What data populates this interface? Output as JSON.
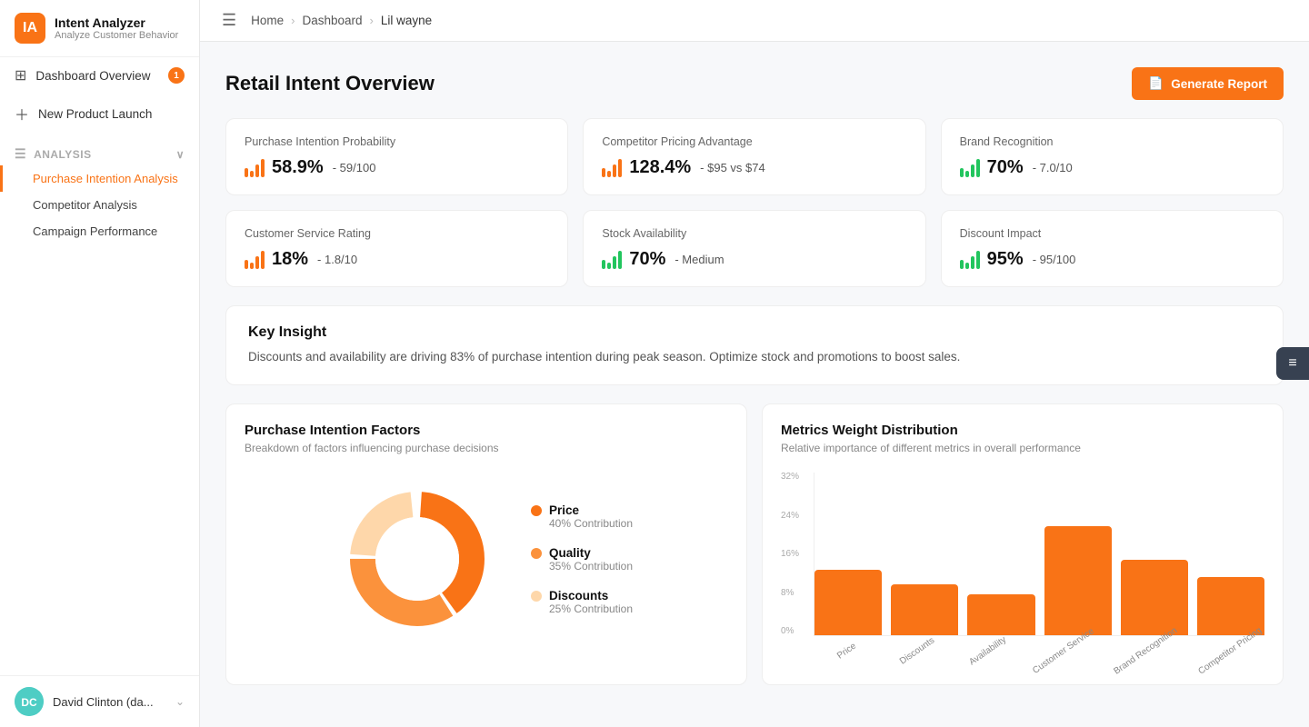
{
  "app": {
    "title": "Intent Analyzer",
    "subtitle": "Analyze Customer Behavior",
    "logo_letter": "IA"
  },
  "sidebar": {
    "nav_items": [
      {
        "id": "dashboard",
        "label": "Dashboard Overview",
        "badge": "1",
        "icon": "⊞"
      },
      {
        "id": "new-product",
        "label": "New Product Launch",
        "icon": "+"
      }
    ],
    "analysis_section": {
      "label": "Analysis",
      "icon": "☰",
      "sub_items": [
        {
          "id": "purchase-intention",
          "label": "Purchase Intention Analysis",
          "active": true
        },
        {
          "id": "competitor",
          "label": "Competitor Analysis",
          "active": false
        },
        {
          "id": "campaign",
          "label": "Campaign Performance",
          "active": false
        }
      ]
    }
  },
  "user": {
    "name": "David Clinton (da...",
    "initials": "DC"
  },
  "breadcrumb": {
    "items": [
      "Home",
      "Dashboard",
      "Lil wayne"
    ]
  },
  "page": {
    "title": "Retail Intent Overview",
    "generate_report_label": "Generate Report"
  },
  "metrics": [
    {
      "label": "Purchase Intention Probability",
      "value": "58.9%",
      "sub": "- 59/100",
      "color": "orange",
      "bars": [
        14,
        10,
        16,
        20
      ]
    },
    {
      "label": "Competitor Pricing Advantage",
      "value": "128.4%",
      "sub": "- $95 vs $74",
      "color": "orange",
      "bars": [
        14,
        10,
        16,
        20
      ]
    },
    {
      "label": "Brand Recognition",
      "value": "70%",
      "sub": "- 7.0/10",
      "color": "green",
      "bars": [
        14,
        10,
        16,
        20
      ]
    },
    {
      "label": "Customer Service Rating",
      "value": "18%",
      "sub": "- 1.8/10",
      "color": "orange",
      "bars": [
        14,
        10,
        16,
        20
      ]
    },
    {
      "label": "Stock Availability",
      "value": "70%",
      "sub": "- Medium",
      "color": "green",
      "bars": [
        14,
        10,
        16,
        20
      ]
    },
    {
      "label": "Discount Impact",
      "value": "95%",
      "sub": "- 95/100",
      "color": "green",
      "bars": [
        14,
        10,
        16,
        20
      ]
    }
  ],
  "key_insight": {
    "title": "Key Insight",
    "text": "Discounts and availability are driving 83% of purchase intention during peak season. Optimize stock and promotions to boost sales."
  },
  "donut_chart": {
    "title": "Purchase Intention Factors",
    "subtitle": "Breakdown of factors influencing purchase decisions",
    "segments": [
      {
        "label": "Price",
        "sub": "40% Contribution",
        "pct": 40,
        "color": "#f97316"
      },
      {
        "label": "Quality",
        "sub": "35% Contribution",
        "pct": 35,
        "color": "#fb923c"
      },
      {
        "label": "Discounts",
        "sub": "25% Contribution",
        "pct": 25,
        "color": "#fed7aa"
      }
    ]
  },
  "bar_chart": {
    "title": "Metrics Weight Distribution",
    "subtitle": "Relative importance of different metrics in overall performance",
    "y_labels": [
      "32%",
      "24%",
      "16%",
      "8%",
      "0%"
    ],
    "bars": [
      {
        "label": "Price",
        "height_pct": 45
      },
      {
        "label": "Discounts",
        "height_pct": 35
      },
      {
        "label": "Availability",
        "height_pct": 28
      },
      {
        "label": "Customer Service",
        "height_pct": 75
      },
      {
        "label": "Brand Recognition",
        "height_pct": 52
      },
      {
        "label": "Competitor Pricing",
        "height_pct": 40
      }
    ]
  }
}
